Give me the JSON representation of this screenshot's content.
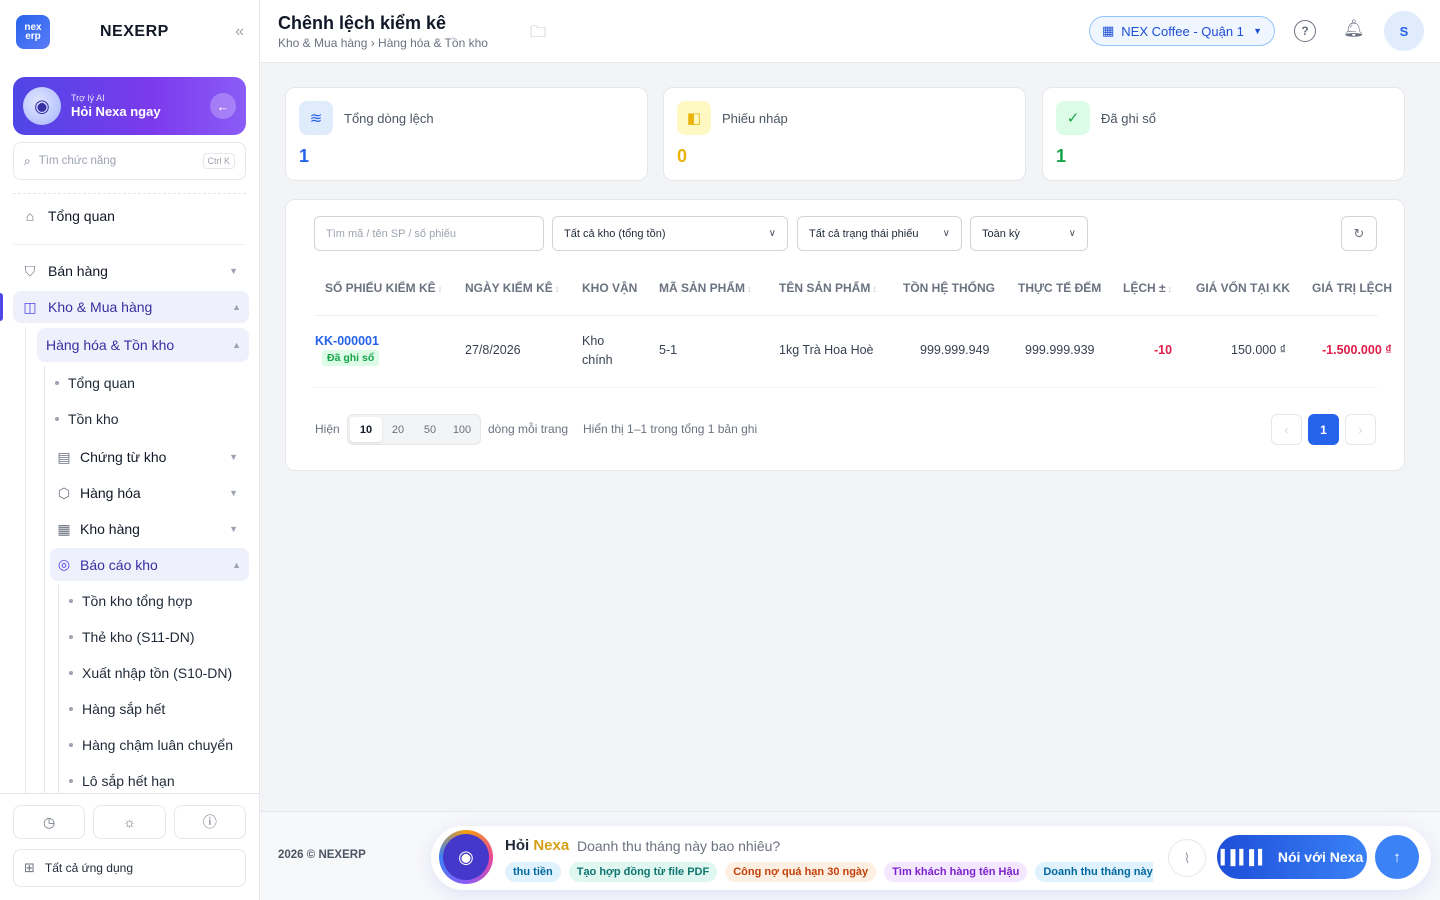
{
  "sidebar": {
    "logo_text": "nex erp",
    "brand": "NEXERP",
    "ai_card": {
      "subtitle": "Trợ lý AI",
      "title": "Hỏi Nexa ngay"
    },
    "search": {
      "placeholder": "Tìm chức năng",
      "shortcut": "Ctrl K"
    },
    "overview": "Tổng quan",
    "sales": "Bán hàng",
    "warehouse": "Kho & Mua hàng",
    "goods_inventory": "Hàng hóa & Tồn kho",
    "sub_overview": "Tổng quan",
    "sub_stock": "Tồn kho",
    "vouchers": "Chứng từ kho",
    "goods": "Hàng hóa",
    "stores": "Kho hàng",
    "reports": "Báo cáo kho",
    "report_items": [
      "Tồn kho tổng hợp",
      "Thẻ kho (S11-DN)",
      "Xuất nhập tồn (S10-DN)",
      "Hàng sắp hết",
      "Hàng chậm luân chuyển",
      "Lô sắp hết hạn"
    ],
    "all_apps": "Tất cả ứng dụng"
  },
  "header": {
    "title": "Chênh lệch kiểm kê",
    "breadcrumb": "Kho & Mua hàng › Hàng hóa & Tồn kho",
    "store": "NEX Coffee - Quận 1",
    "avatar": "S"
  },
  "stats": [
    {
      "label": "Tổng dòng lệch",
      "value": "1",
      "color": "#2563eb"
    },
    {
      "label": "Phiếu nháp",
      "value": "0",
      "color": "#eab308"
    },
    {
      "label": "Đã ghi sổ",
      "value": "1",
      "color": "#16a34a"
    }
  ],
  "filters": {
    "search_placeholder": "Tìm mã / tên SP / số phiếu",
    "warehouse": "Tất cả kho (tổng tồn)",
    "status": "Tất cả trạng thái phiếu",
    "period": "Toàn kỳ"
  },
  "table": {
    "columns": [
      "SỐ PHIẾU KIỂM KÊ",
      "NGÀY KIỂM KÊ",
      "KHO VẬN",
      "MÃ SẢN PHẨM",
      "TÊN SẢN PHẨM",
      "TỒN HỆ THỐNG",
      "THỰC TẾ ĐẾM",
      "LỆCH ±",
      "GIÁ VỐN TẠI KK",
      "GIÁ TRỊ LỆCH"
    ],
    "row": {
      "code": "KK-000001",
      "status": "Đã ghi sổ",
      "date": "27/8/2026",
      "warehouse_line1": "Kho",
      "warehouse_line2": "chính",
      "sku": "5-1",
      "name": "1kg Trà Hoa Hoè",
      "system_qty": "999.999.949",
      "counted_qty": "999.999.939",
      "diff": "-10",
      "cost": "150.000 ₫",
      "diff_value": "-1.500.000 ₫"
    }
  },
  "pagination": {
    "show_label": "Hiện",
    "sizes": [
      "10",
      "20",
      "50",
      "100"
    ],
    "per_page_label": "dòng mỗi trang",
    "summary": "Hiển thị 1–1 trong tổng 1 bản ghi",
    "current_page": "1"
  },
  "footer": {
    "copyright": "2026 © NEXERP",
    "chat_title_a": "Hỏi",
    "chat_title_b": "Nexa",
    "chat_prompt": "Doanh thu tháng này bao nhiêu?",
    "chips": [
      "thu tiền",
      "Tạo hợp đồng từ file PDF",
      "Công nợ quá hạn 30 ngày",
      "Tìm khách hàng tên Hậu",
      "Doanh thu tháng này"
    ],
    "voice_label": "Nói với Nexa"
  },
  "colors": {
    "primary": "#2563eb",
    "accent": "#4f46e5",
    "negative": "#e11d48"
  }
}
